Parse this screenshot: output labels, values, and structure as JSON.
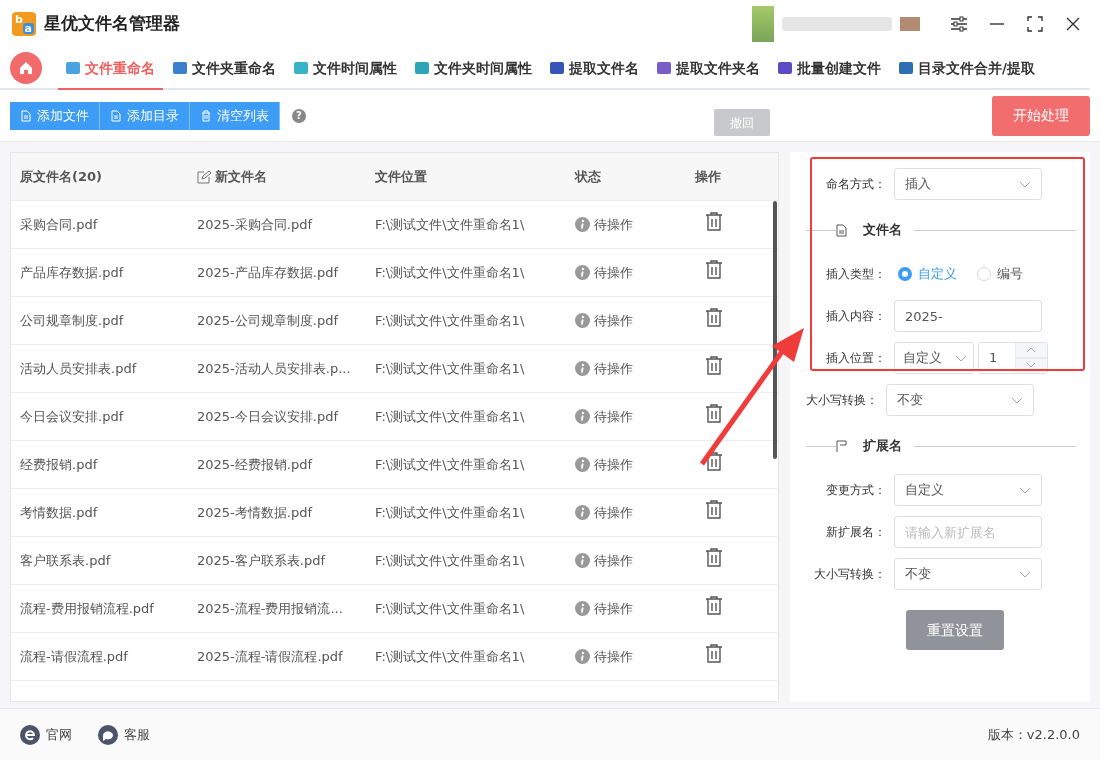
{
  "window": {
    "title": "星优文件名管理器",
    "logo": [
      "b",
      "a"
    ]
  },
  "tabs": [
    {
      "label": "文件重命名",
      "selected": true,
      "color": "#4aa3e0"
    },
    {
      "label": "文件夹重命名",
      "selected": false,
      "color": "#3b7fd1"
    },
    {
      "label": "文件时间属性",
      "selected": false,
      "color": "#38b2c8"
    },
    {
      "label": "文件夹时间属性",
      "selected": false,
      "color": "#2fa3b8"
    },
    {
      "label": "提取文件名",
      "selected": false,
      "color": "#3556b8"
    },
    {
      "label": "提取文件夹名",
      "selected": false,
      "color": "#7a5cc8"
    },
    {
      "label": "批量创建文件",
      "selected": false,
      "color": "#5b4bc4"
    },
    {
      "label": "目录文件合并/提取",
      "selected": false,
      "color": "#2e6fb3"
    }
  ],
  "toolbar": {
    "buttons": [
      {
        "label": "添加文件",
        "kind": "file"
      },
      {
        "label": "添加目录",
        "kind": "file"
      },
      {
        "label": "清空列表",
        "kind": "trash"
      }
    ],
    "help": "?",
    "undo": "撤回",
    "start": "开始处理"
  },
  "table": {
    "columns": [
      "原文件名(20)",
      "新文件名",
      "文件位置",
      "状态",
      "操作"
    ],
    "rows": [
      {
        "original": "采购合同.pdf",
        "new": "2025-采购合同.pdf",
        "location": "F:\\测试文件\\文件重命名1\\",
        "status": "待操作"
      },
      {
        "original": "产品库存数据.pdf",
        "new": "2025-产品库存数据.pdf",
        "location": "F:\\测试文件\\文件重命名1\\",
        "status": "待操作"
      },
      {
        "original": "公司规章制度.pdf",
        "new": "2025-公司规章制度.pdf",
        "location": "F:\\测试文件\\文件重命名1\\",
        "status": "待操作"
      },
      {
        "original": "活动人员安排表.pdf",
        "new": "2025-活动人员安排表.p...",
        "location": "F:\\测试文件\\文件重命名1\\",
        "status": "待操作"
      },
      {
        "original": "今日会议安排.pdf",
        "new": "2025-今日会议安排.pdf",
        "location": "F:\\测试文件\\文件重命名1\\",
        "status": "待操作"
      },
      {
        "original": "经费报销.pdf",
        "new": "2025-经费报销.pdf",
        "location": "F:\\测试文件\\文件重命名1\\",
        "status": "待操作"
      },
      {
        "original": "考情数据.pdf",
        "new": "2025-考情数据.pdf",
        "location": "F:\\测试文件\\文件重命名1\\",
        "status": "待操作"
      },
      {
        "original": "客户联系表.pdf",
        "new": "2025-客户联系表.pdf",
        "location": "F:\\测试文件\\文件重命名1\\",
        "status": "待操作"
      },
      {
        "original": "流程-费用报销流程.pdf",
        "new": "2025-流程-费用报销流...",
        "location": "F:\\测试文件\\文件重命名1\\",
        "status": "待操作"
      },
      {
        "original": "流程-请假流程.pdf",
        "new": "2025-流程-请假流程.pdf",
        "location": "F:\\测试文件\\文件重命名1\\",
        "status": "待操作"
      }
    ]
  },
  "settings": [
    {
      "kind": "select",
      "label": "命名方式：",
      "value": "插入"
    },
    {
      "kind": "section",
      "title": "文件名"
    },
    {
      "kind": "radio",
      "label": "插入类型：",
      "options": [
        {
          "label": "自定义",
          "selected": true
        },
        {
          "label": "编号",
          "selected": false
        }
      ]
    },
    {
      "kind": "input",
      "label": "插入内容：",
      "value": "2025-"
    },
    {
      "kind": "position",
      "label": "插入位置：",
      "value": "自定义",
      "number": "1"
    },
    {
      "kind": "select",
      "label": "大小写转换：",
      "value": "不变"
    },
    {
      "kind": "section",
      "title": "扩展名"
    },
    {
      "kind": "select",
      "label": "变更方式：",
      "value": "自定义"
    },
    {
      "kind": "input",
      "label": "新扩展名：",
      "placeholder": "请输入新扩展名"
    },
    {
      "kind": "select",
      "label": "大小写转换：",
      "value": "不变"
    }
  ],
  "reset_button": "重置设置",
  "footer": {
    "links": [
      {
        "label": "官网",
        "kind": "web"
      },
      {
        "label": "客服",
        "kind": "chat"
      }
    ],
    "version": "版本：v2.2.0.0"
  }
}
